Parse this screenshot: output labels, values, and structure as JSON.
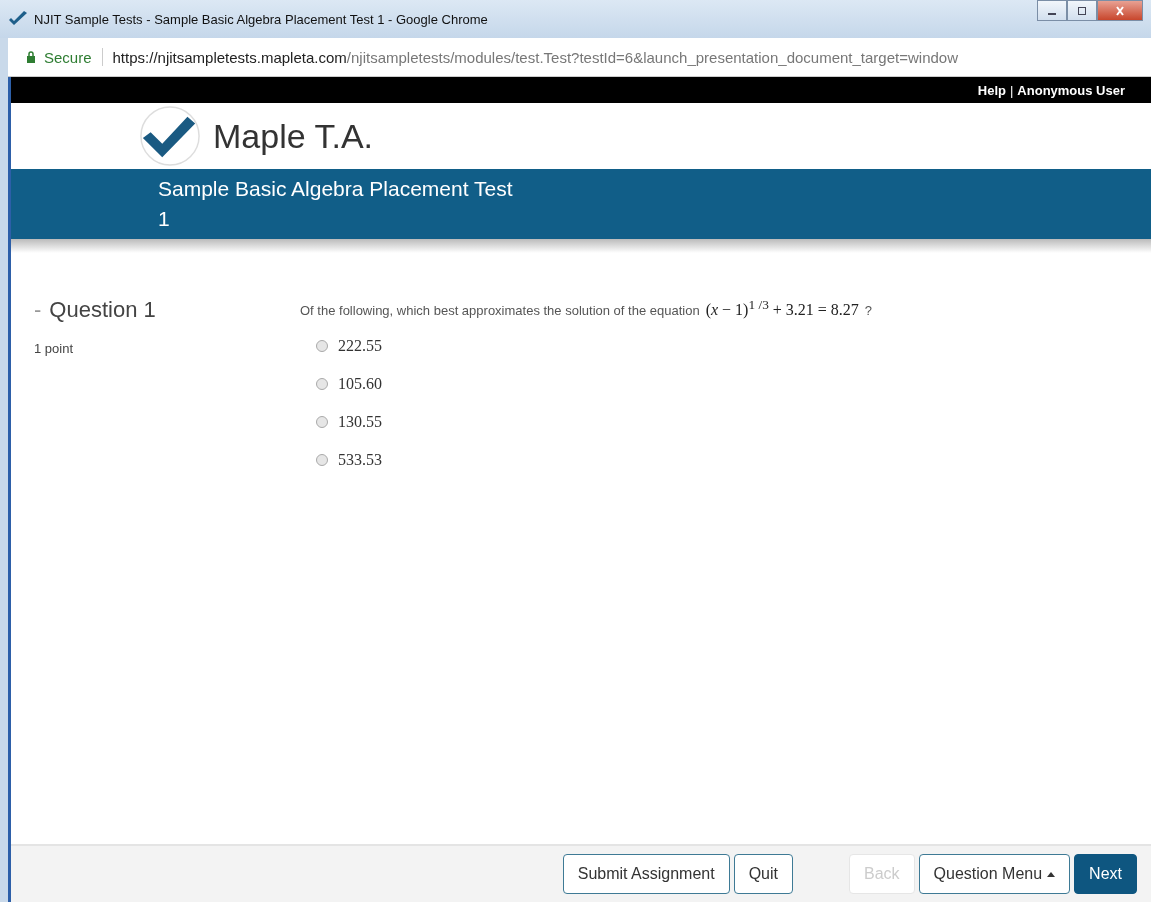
{
  "window": {
    "title": "NJIT Sample Tests - Sample Basic Algebra Placement Test 1 - Google Chrome"
  },
  "address_bar": {
    "secure_label": "Secure",
    "url_host": "https://njitsampletests.mapleta.com",
    "url_path": "/njitsampletests/modules/test.Test?testId=6&launch_presentation_document_target=window"
  },
  "top_bar": {
    "help": "Help",
    "separator": "|",
    "user": "Anonymous User"
  },
  "logo": {
    "text": "Maple T.A."
  },
  "banner": {
    "title": "Sample Basic Algebra Placement Test",
    "subtitle": "1"
  },
  "question": {
    "collapse": "-",
    "title": "Question 1",
    "points": "1 point",
    "prompt": "Of the following, which best approximates the solution of the equation",
    "equation": "(*x* − 1)$^{1 /3}$ + 3.21 = 8.27",
    "end": "?",
    "options": [
      {
        "label": "222.55",
        "selected": false
      },
      {
        "label": "105.60",
        "selected": false
      },
      {
        "label": "130.55",
        "selected": false
      },
      {
        "label": "533.53",
        "selected": false
      }
    ]
  },
  "footer": {
    "buttons": [
      {
        "label": "Submit Assignment",
        "kind": "default",
        "disabled": false
      },
      {
        "label": "Quit",
        "kind": "default",
        "disabled": false
      },
      {
        "label": "Back",
        "kind": "default",
        "disabled": true
      },
      {
        "label": "Question Menu",
        "kind": "menu",
        "disabled": false
      },
      {
        "label": "Next",
        "kind": "primary",
        "disabled": false
      }
    ]
  }
}
